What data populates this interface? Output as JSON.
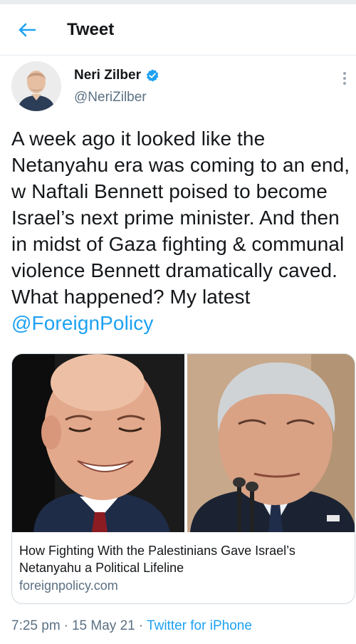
{
  "header": {
    "back_icon": "back-arrow-icon",
    "title": "Tweet"
  },
  "author": {
    "name": "Neri Zilber",
    "handle": "@NeriZilber",
    "verified_icon": "verified-badge-icon",
    "more_icon": "more-vertical-icon"
  },
  "tweet": {
    "text_before_mention": "A week ago it looked like the Netanyahu era was coming to an end, w Naftali Bennett poised to become Israel’s next prime minister. And then in midst of Gaza fighting & communal violence Bennett dramatically caved. What happened? My latest ",
    "mention": "@ForeignPolicy"
  },
  "card": {
    "title": "How Fighting With the Palestinians Gave Israel’s Netanyahu a Political Lifeline",
    "domain": "foreignpolicy.com"
  },
  "meta": {
    "time": "7:25 pm",
    "separator_1": "·",
    "date": "15 May 21",
    "separator_2": "·",
    "source": "Twitter for iPhone"
  },
  "colors": {
    "accent": "#1da1f2",
    "secondary_text": "#5b7083",
    "primary_text": "#14171a",
    "border": "#cfd9de"
  }
}
